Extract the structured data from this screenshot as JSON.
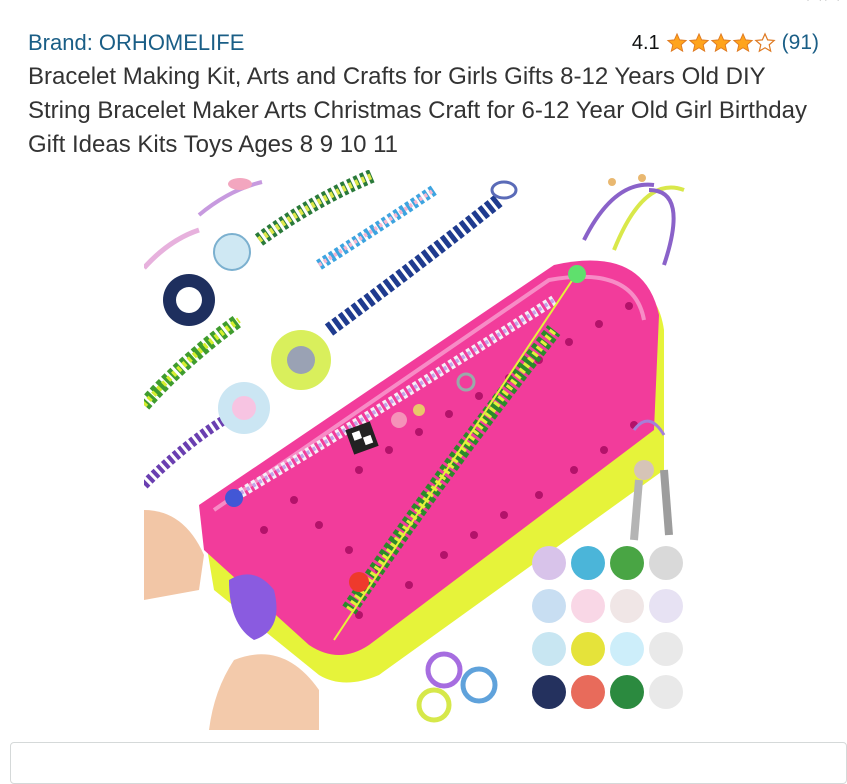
{
  "product": {
    "brand_label": "Brand: ORHOMELIFE",
    "rating_value": "4.1",
    "rating_stars": 4.1,
    "review_count": "(91)",
    "title": "Bracelet Making Kit, Arts and Crafts for Girls Gifts 8-12 Years Old DIY String Bracelet Maker Arts Christmas Craft for 6-12 Year Old Girl Birthday Gift Ideas Kits Toys Ages 8 9 10 11"
  },
  "colors": {
    "link": "#1a5e86",
    "star_fill": "#ffa41c",
    "board_pink": "#f23c9b",
    "board_yellow": "#e6f33a"
  }
}
